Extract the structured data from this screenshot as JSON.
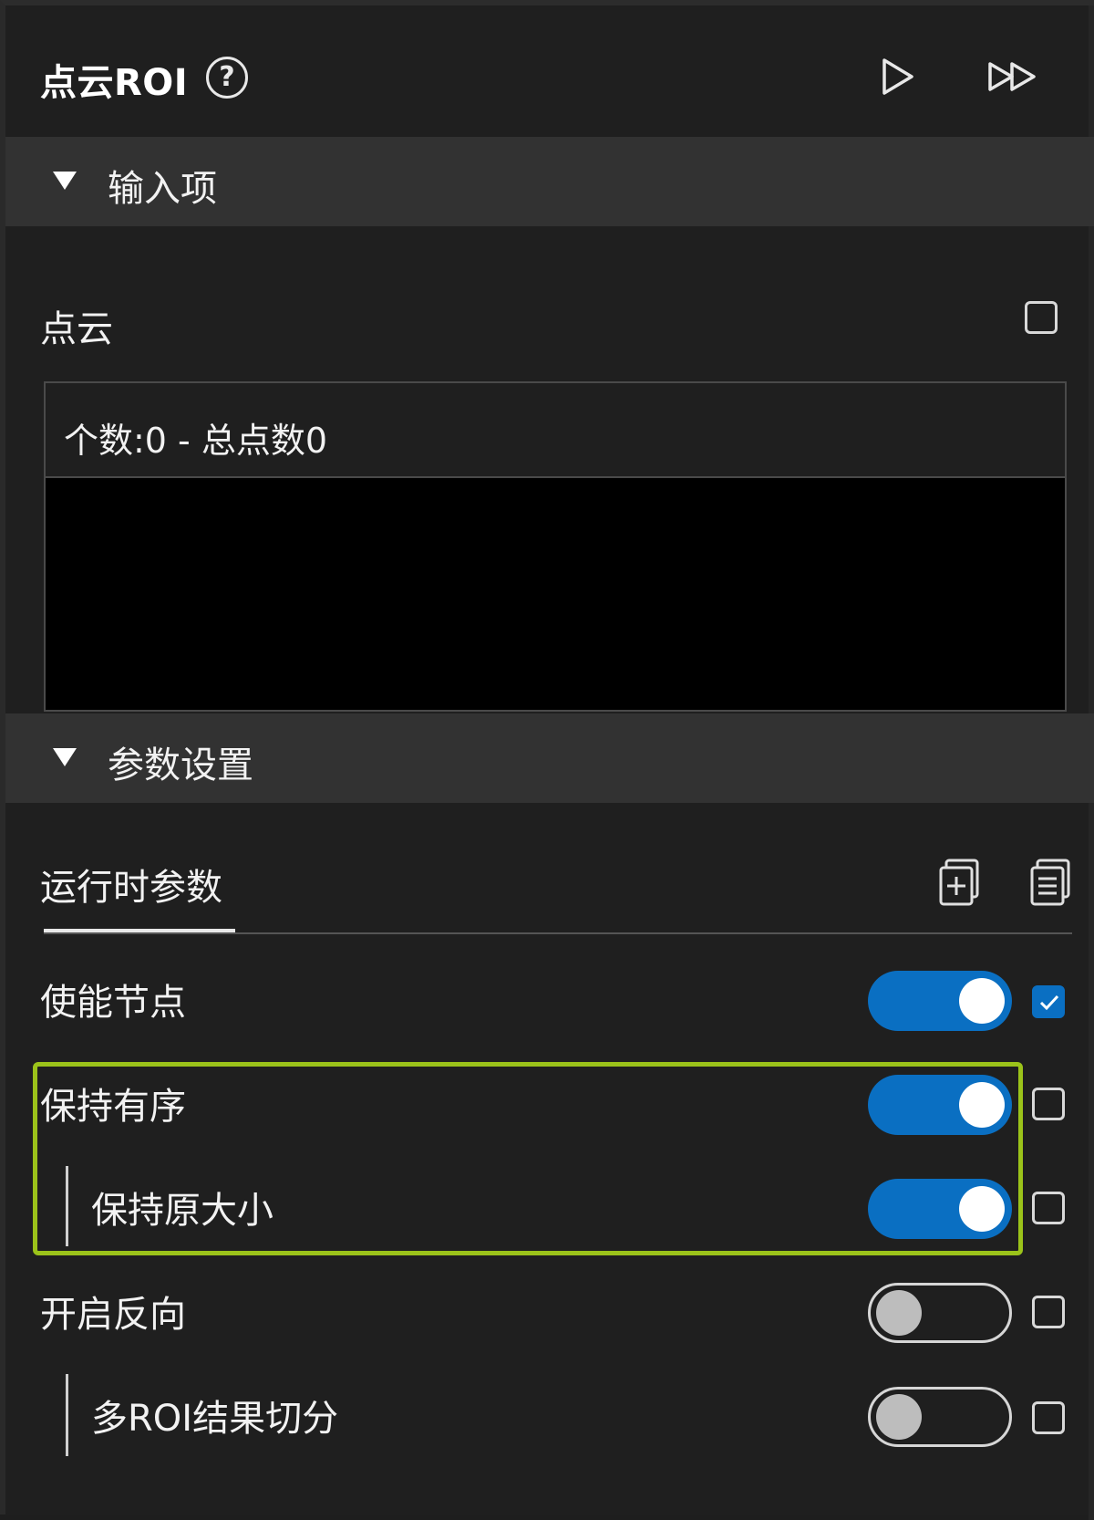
{
  "header": {
    "title": "点云ROI",
    "help_glyph": "?",
    "icons": [
      "help-icon",
      "run-once-icon",
      "run-all-icon"
    ]
  },
  "input_section": {
    "label": "输入项",
    "point_cloud": {
      "label": "点云",
      "checked": false,
      "summary": "个数:0 - 总点数0"
    }
  },
  "param_section": {
    "label": "参数设置",
    "tab": "运行时参数",
    "icons": [
      "copy-params-icon",
      "paste-params-icon"
    ],
    "rows": [
      {
        "label": "使能节点",
        "toggle_on": true,
        "checked": true,
        "indented": false
      },
      {
        "label": "保持有序",
        "toggle_on": true,
        "checked": false,
        "indented": false
      },
      {
        "label": "保持原大小",
        "toggle_on": true,
        "checked": false,
        "indented": true
      },
      {
        "label": "开启反向",
        "toggle_on": false,
        "checked": false,
        "indented": false
      },
      {
        "label": "多ROI结果切分",
        "toggle_on": false,
        "checked": false,
        "indented": true
      }
    ]
  },
  "colors": {
    "accent": "#0a6fc2",
    "highlight": "#9bc31a",
    "panel_bg": "#1f1f1f",
    "section_bg": "#323232"
  }
}
